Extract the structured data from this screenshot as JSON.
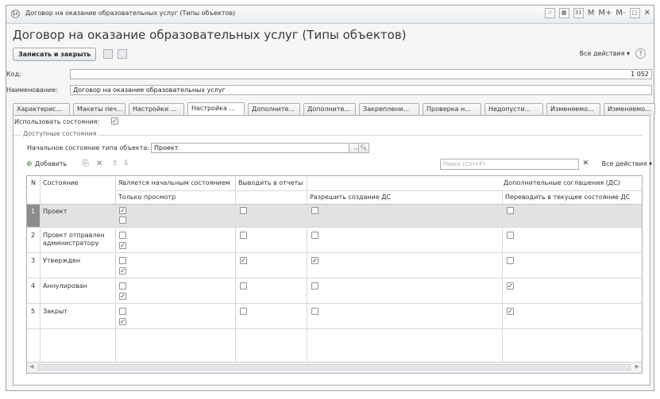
{
  "window": {
    "title": "Договор на оказание образовательных услуг (Типы объектов)"
  },
  "titlebar_buttons": {
    "m": "M",
    "mplus": "M+",
    "mminus": "M-"
  },
  "page": {
    "heading": "Договор на оказание образовательных услуг (Типы объектов)"
  },
  "toolbar": {
    "save_close_label": "Записать и закрыть",
    "all_actions_label": "Все действия ▾",
    "help": "?"
  },
  "form": {
    "code_label": "Код:",
    "code_value": "1 052",
    "name_label": "Наименование:",
    "name_value": "Договор на оказание образовательных услуг"
  },
  "tabs": [
    {
      "label": "Характерис..."
    },
    {
      "label": "Макеты печ..."
    },
    {
      "label": "Настройки ..."
    },
    {
      "label": "Настройка ..."
    },
    {
      "label": "Дополните..."
    },
    {
      "label": "Дополните..."
    },
    {
      "label": "Закреплени..."
    },
    {
      "label": "Проверка н..."
    },
    {
      "label": "Недопусти..."
    },
    {
      "label": "Изменяемо..."
    },
    {
      "label": "Изменяемо..."
    }
  ],
  "panel": {
    "use_states_label": "Использовать состояния:",
    "use_states_checked": true,
    "group_title": "Доступные состояния",
    "initial_state_label": "Начальное состояние типа объекта:",
    "initial_state_value": "Проект",
    "pick_label": "...",
    "add_label": "Добавить",
    "search_placeholder": "Поиск (Ctrl+F)",
    "all_actions_label": "Все действия ▾"
  },
  "table": {
    "headers": {
      "n": "N",
      "state": "Состояние",
      "initial": "Является начальным состоянием",
      "readonly": "Только просмотр",
      "reports": "Выводить в отчеты",
      "allow_create": "Разрешить создание ДС",
      "agreements": "Дополнительные соглашения (ДС)",
      "transfer": "Переводить в текущее состояние ДС"
    },
    "rows": [
      {
        "n": "1",
        "state": "Проект",
        "initial": true,
        "readonly": false,
        "reports": false,
        "allow_create": false,
        "transfer": false
      },
      {
        "n": "2",
        "state": "Проект отправлен администратору",
        "initial": false,
        "readonly": true,
        "reports": false,
        "allow_create": false,
        "transfer": false
      },
      {
        "n": "3",
        "state": "Утвержден",
        "initial": false,
        "readonly": true,
        "reports": true,
        "allow_create": true,
        "transfer": false
      },
      {
        "n": "4",
        "state": "Аннулирован",
        "initial": false,
        "readonly": true,
        "reports": false,
        "allow_create": false,
        "transfer": true
      },
      {
        "n": "5",
        "state": "Закрыт",
        "initial": false,
        "readonly": true,
        "reports": false,
        "allow_create": false,
        "transfer": true
      }
    ]
  }
}
